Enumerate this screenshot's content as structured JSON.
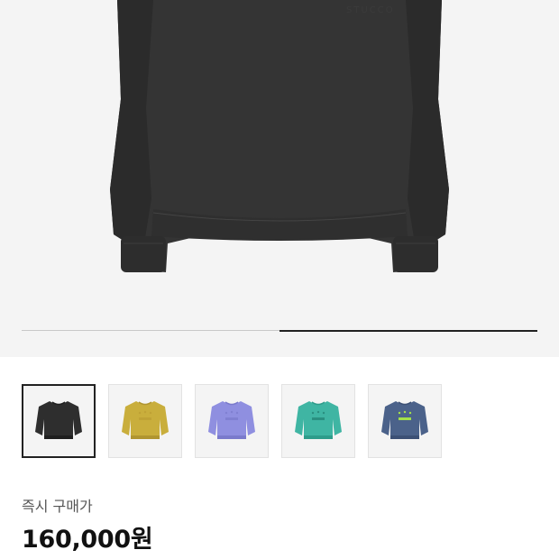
{
  "hero": {
    "image_alt": "charcoal-sweatshirt-photo",
    "logo_text": "STUCCO",
    "progress": 0.5
  },
  "thumbnails": [
    {
      "color_name": "charcoal",
      "body": "#2e2e2e",
      "shade": "#1f1f1f",
      "logo": "#3a3a3a",
      "selected": true
    },
    {
      "color_name": "mustard",
      "body": "#c9ae3c",
      "shade": "#b09530",
      "logo": "#bfa235",
      "selected": false
    },
    {
      "color_name": "lavender",
      "body": "#8f8fe0",
      "shade": "#7a7acc",
      "logo": "#8080d2",
      "selected": false
    },
    {
      "color_name": "teal",
      "body": "#3fb5a3",
      "shade": "#2e9c8b",
      "logo": "#2a8f80",
      "selected": false
    },
    {
      "color_name": "navy",
      "body": "#4b628a",
      "shade": "#3c5075",
      "logo": "#a4e04a",
      "selected": false
    }
  ],
  "purchase": {
    "label": "즉시 구매가",
    "price": "160,000원"
  }
}
